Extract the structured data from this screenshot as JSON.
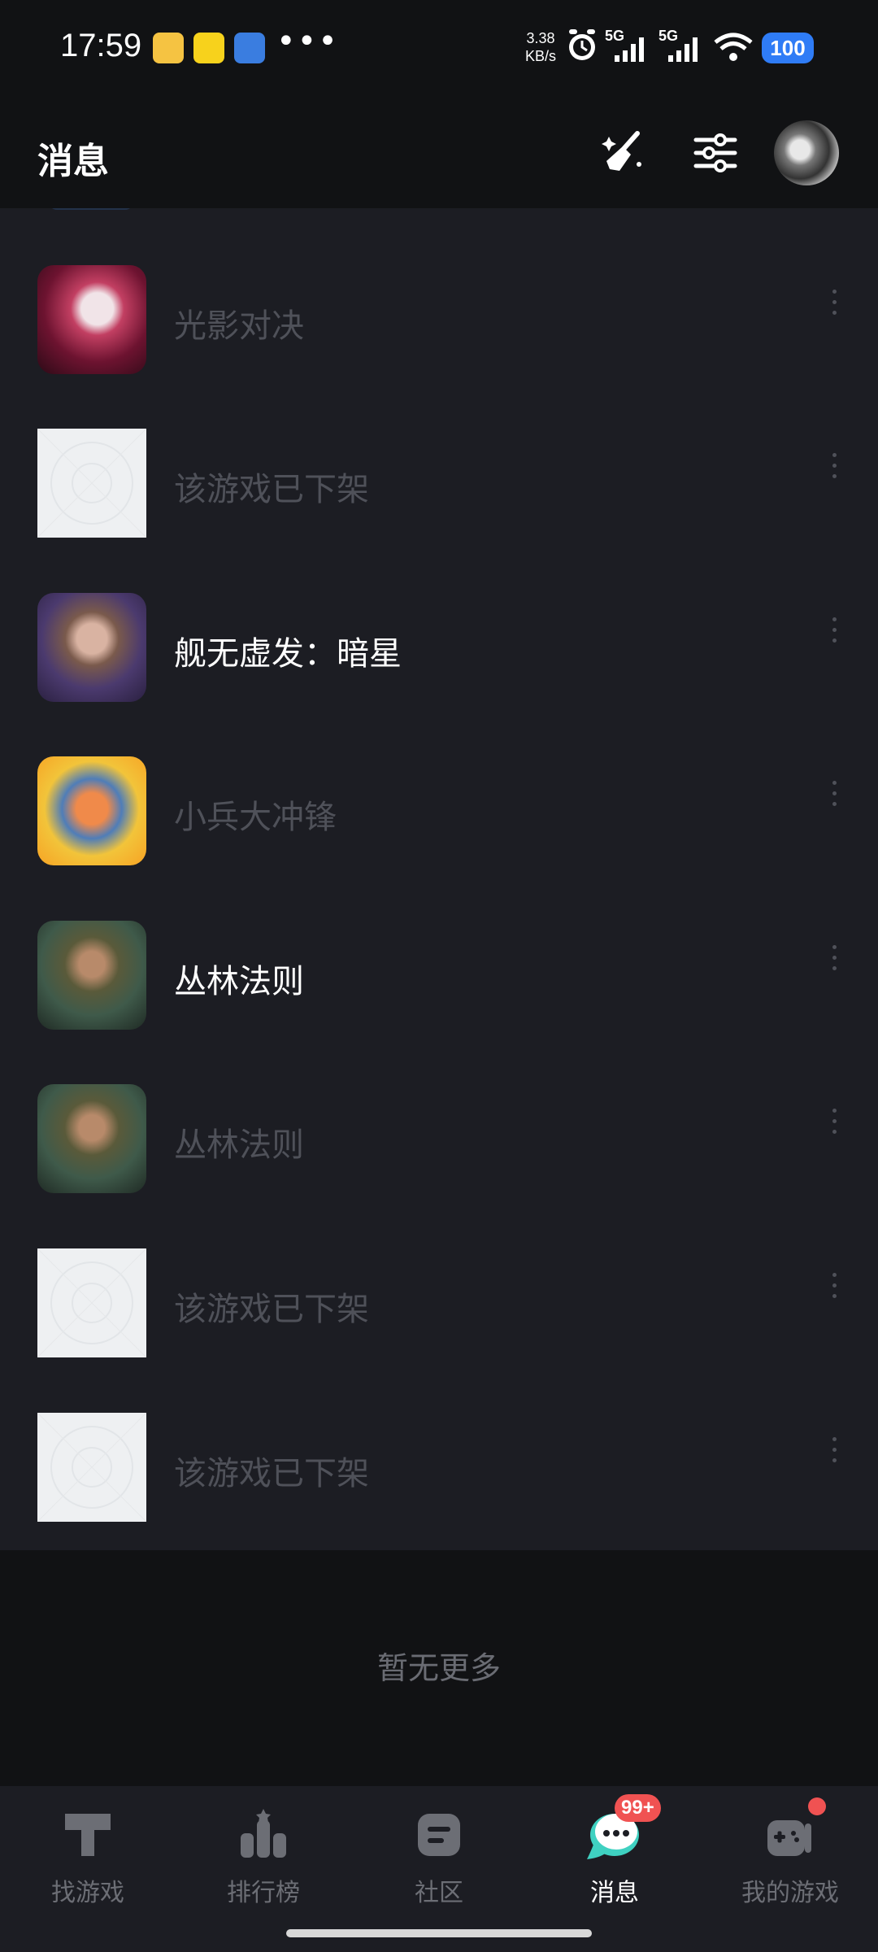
{
  "status_bar": {
    "time": "17:59",
    "net_speed_value": "3.38",
    "net_speed_unit": "KB/s",
    "signal1": "5G",
    "signal2": "5G",
    "battery": "100"
  },
  "header": {
    "title": "消息"
  },
  "list": {
    "items": [
      {
        "title": "光影对决",
        "read": true,
        "thumb": "dark-hero"
      },
      {
        "title": "该游戏已下架",
        "read": true,
        "thumb": "placeholder"
      },
      {
        "title": "舰无虚发：暗星",
        "read": false,
        "thumb": "woman-portrait"
      },
      {
        "title": "小兵大冲锋",
        "read": true,
        "thumb": "cartoon-soldier"
      },
      {
        "title": "丛林法则",
        "read": false,
        "thumb": "jungle-soldier"
      },
      {
        "title": "丛林法则",
        "read": true,
        "thumb": "jungle-soldier"
      },
      {
        "title": "该游戏已下架",
        "read": true,
        "thumb": "placeholder"
      },
      {
        "title": "该游戏已下架",
        "read": true,
        "thumb": "placeholder"
      }
    ],
    "end_text": "暂无更多"
  },
  "tabbar": {
    "tabs": [
      {
        "label": "找游戏",
        "icon": "find-games-icon"
      },
      {
        "label": "排行榜",
        "icon": "leaderboard-icon"
      },
      {
        "label": "社区",
        "icon": "community-icon"
      },
      {
        "label": "消息",
        "icon": "messages-icon",
        "badge": "99+",
        "active": true
      },
      {
        "label": "我的游戏",
        "icon": "my-games-icon"
      }
    ]
  },
  "colors": {
    "background": "#1c1d23",
    "bar": "#111214",
    "dim_text": "#4f5159",
    "badge": "#f05252",
    "battery": "#2f7cf6",
    "active_tab_accent": "#3fd1c1"
  }
}
